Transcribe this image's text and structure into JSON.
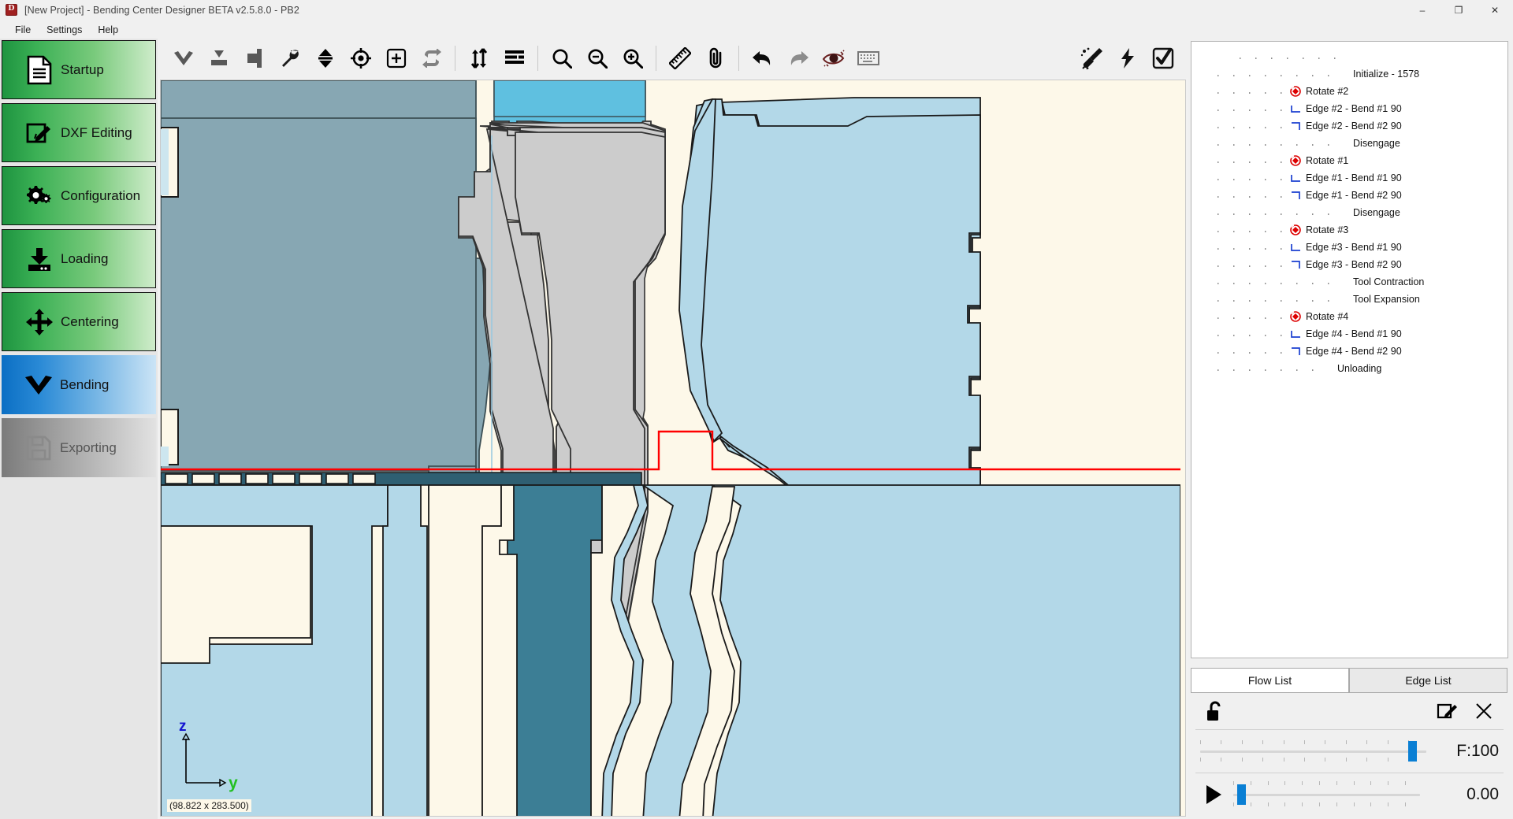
{
  "titlebar": {
    "title": "[New Project] - Bending Center Designer BETA v2.5.8.0 - PB2",
    "app_icon": "app-logo-icon",
    "minimize": "–",
    "maximize": "❐",
    "close": "✕"
  },
  "menubar": {
    "items": [
      {
        "label": "File"
      },
      {
        "label": "Settings"
      },
      {
        "label": "Help"
      }
    ]
  },
  "sidebar": {
    "items": [
      {
        "label": "Startup",
        "icon": "document-icon",
        "state": "green"
      },
      {
        "label": "DXF Editing",
        "icon": "edit-box-icon",
        "state": "green"
      },
      {
        "label": "Configuration",
        "icon": "gears-icon",
        "state": "green"
      },
      {
        "label": "Loading",
        "icon": "download-icon",
        "state": "green"
      },
      {
        "label": "Centering",
        "icon": "move-arrows-icon",
        "state": "green"
      },
      {
        "label": "Bending",
        "icon": "chevron-down-icon",
        "state": "active"
      },
      {
        "label": "Exporting",
        "icon": "floppy-save-icon",
        "state": "disabled"
      }
    ]
  },
  "toolbar": {
    "groups": [
      {
        "buttons": [
          {
            "name": "bend-down-icon",
            "title": "Bend Down"
          },
          {
            "name": "bend-to-plane-icon",
            "title": "Bend To Plane"
          },
          {
            "name": "tool-block-icon",
            "title": "Tool Block"
          },
          {
            "name": "wrench-icon",
            "title": "Tools"
          },
          {
            "name": "updown-arrows-icon",
            "title": "Up / Down"
          },
          {
            "name": "crosshair-icon",
            "title": "Center Target"
          },
          {
            "name": "add-box-icon",
            "title": "Add"
          },
          {
            "name": "repeat-icon",
            "title": "Repeat"
          }
        ]
      },
      {
        "buttons": [
          {
            "name": "sort-arrows-icon",
            "title": "Sort"
          },
          {
            "name": "list-lines-icon",
            "title": "List"
          }
        ]
      },
      {
        "buttons": [
          {
            "name": "search-icon",
            "title": "Search"
          },
          {
            "name": "zoom-out-icon",
            "title": "Zoom Out"
          },
          {
            "name": "zoom-in-icon",
            "title": "Zoom In"
          }
        ]
      },
      {
        "buttons": [
          {
            "name": "ruler-icon",
            "title": "Measure"
          },
          {
            "name": "paperclip-icon",
            "title": "Attach"
          }
        ]
      },
      {
        "buttons": [
          {
            "name": "undo-icon",
            "title": "Undo"
          },
          {
            "name": "redo-icon",
            "title": "Redo"
          },
          {
            "name": "eye-visibility-icon",
            "title": "Visibility"
          },
          {
            "name": "keyboard-icon",
            "title": "Keyboard"
          }
        ]
      }
    ],
    "right_buttons": [
      {
        "name": "broom-clean-icon",
        "title": "Clean"
      },
      {
        "name": "lightning-icon",
        "title": "Auto"
      },
      {
        "name": "checkbox-ok-icon",
        "title": "Confirm"
      }
    ]
  },
  "canvas": {
    "dimension_label": "(98.822 x 283.500)",
    "axis": {
      "vertical": "z",
      "horizontal": "y"
    },
    "colors": {
      "background": "#fdf8e9",
      "steel_gray_blue": "#87a7b3",
      "light_blue": "#b3d8e8",
      "cyan": "#5fc0e0",
      "dark_teal": "#3c7e95",
      "tool_gray": "#cccccc",
      "bend_line_red": "#ff0000"
    }
  },
  "tree": {
    "items": [
      {
        "depth": 8,
        "icon": "none",
        "label": "Initialize - 1578"
      },
      {
        "depth": 5,
        "icon": "rotate",
        "label": "Rotate #2"
      },
      {
        "depth": 5,
        "icon": "bend-l",
        "label": "Edge #2 - Bend #1 90"
      },
      {
        "depth": 5,
        "icon": "bend-r",
        "label": "Edge #2 - Bend #2 90"
      },
      {
        "depth": 8,
        "icon": "none",
        "label": "Disengage"
      },
      {
        "depth": 5,
        "icon": "rotate",
        "label": "Rotate #1"
      },
      {
        "depth": 5,
        "icon": "bend-l",
        "label": "Edge #1 - Bend #1 90"
      },
      {
        "depth": 5,
        "icon": "bend-r",
        "label": "Edge #1 - Bend #2 90"
      },
      {
        "depth": 8,
        "icon": "none",
        "label": "Disengage"
      },
      {
        "depth": 5,
        "icon": "rotate",
        "label": "Rotate #3"
      },
      {
        "depth": 5,
        "icon": "bend-l",
        "label": "Edge #3 - Bend #1 90"
      },
      {
        "depth": 5,
        "icon": "bend-r",
        "label": "Edge #3 - Bend #2 90"
      },
      {
        "depth": 8,
        "icon": "none",
        "label": "Tool Contraction"
      },
      {
        "depth": 8,
        "icon": "none",
        "label": "Tool Expansion"
      },
      {
        "depth": 5,
        "icon": "rotate",
        "label": "Rotate #4"
      },
      {
        "depth": 5,
        "icon": "bend-l",
        "label": "Edge #4 - Bend #1 90"
      },
      {
        "depth": 5,
        "icon": "bend-r",
        "label": "Edge #4 - Bend #2 90"
      },
      {
        "depth": 7,
        "icon": "none",
        "label": "Unloading"
      }
    ],
    "root_dots": ". . . . . . ."
  },
  "tabs": [
    {
      "label": "Flow List",
      "active": true
    },
    {
      "label": "Edge List",
      "active": false
    }
  ],
  "controls": {
    "lock_icon": "unlock-icon",
    "edit_icon": "edit-pencil-icon",
    "close_icon": "close-x-icon",
    "feed": {
      "label": "F:100",
      "value": 100,
      "max": 100,
      "percent": 92
    },
    "position": {
      "value": "0.00",
      "percent": 2
    },
    "play_icon": "play-icon"
  }
}
